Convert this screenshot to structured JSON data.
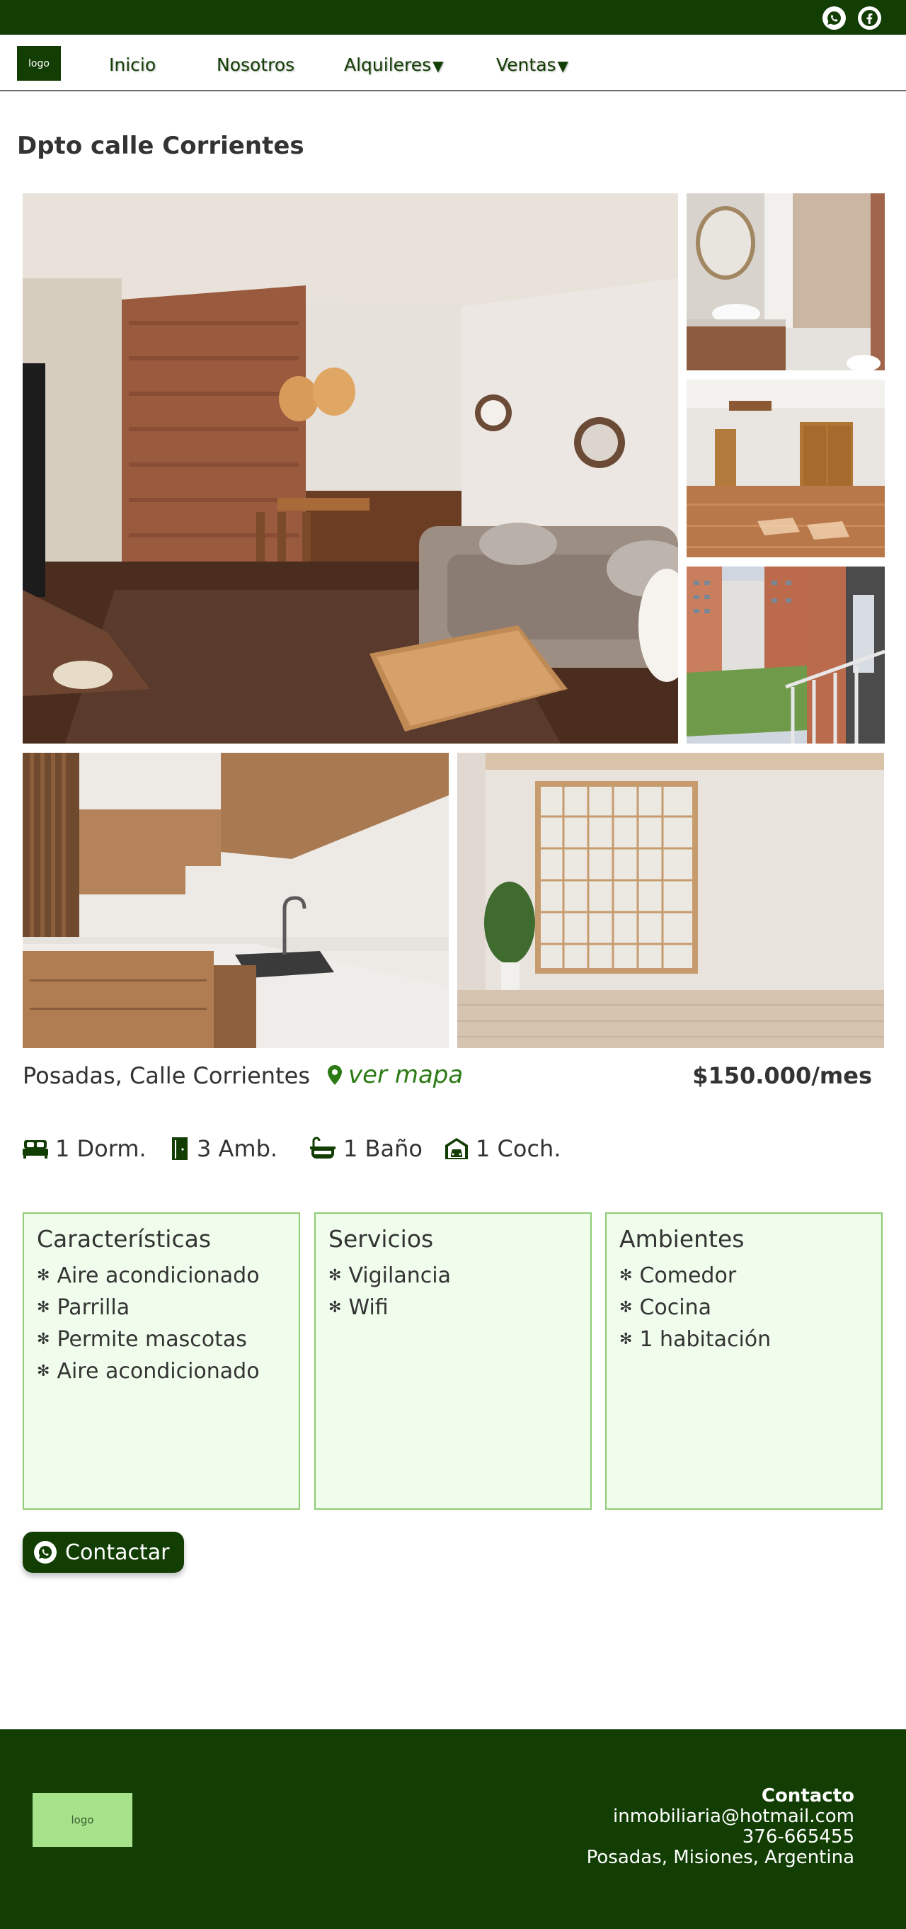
{
  "topbar": {
    "icons": [
      "whatsapp-icon",
      "facebook-icon"
    ],
    "bg_color": "#123e04"
  },
  "nav": {
    "logo_text": "logo",
    "items": [
      {
        "label": "Inicio",
        "has_dropdown": false
      },
      {
        "label": "Nosotros",
        "has_dropdown": false
      },
      {
        "label": "Alquileres",
        "has_dropdown": true
      },
      {
        "label": "Ventas",
        "has_dropdown": true
      }
    ],
    "dropdown_glyph": "▼"
  },
  "listing": {
    "title": "Dpto calle Corrientes",
    "location": "Posadas, Calle Corrientes",
    "map_link": "ver mapa",
    "price": "$150.000/mes",
    "features": [
      {
        "icon": "bed-icon",
        "text": "1 Dorm."
      },
      {
        "icon": "door-icon",
        "text": "3 Amb."
      },
      {
        "icon": "bathtub-icon",
        "text": "1 Baño"
      },
      {
        "icon": "garage-icon",
        "text": "1 Coch."
      }
    ],
    "cards": [
      {
        "title": "Características",
        "items": [
          "Aire acondicionado",
          "Parrilla",
          "Permite mascotas",
          "Aire acondicionado"
        ]
      },
      {
        "title": "Servicios",
        "items": [
          "Vigilancia",
          "Wifi"
        ]
      },
      {
        "title": "Ambientes",
        "items": [
          "Comedor",
          "Cocina",
          "1 habitación"
        ]
      }
    ],
    "contact_button": "Contactar"
  },
  "footer": {
    "logo_text": "logo",
    "contact_title": "Contacto",
    "email": "inmobiliaria@hotmail.com",
    "phone": "376-665455",
    "address": "Posadas, Misiones, Argentina"
  },
  "colors": {
    "brand_dark_green": "#123e04",
    "link_green": "#2b7a14",
    "card_bg": "#f0fdec",
    "card_border": "#8fcc75",
    "footer_logo_bg": "#a5e28a"
  }
}
